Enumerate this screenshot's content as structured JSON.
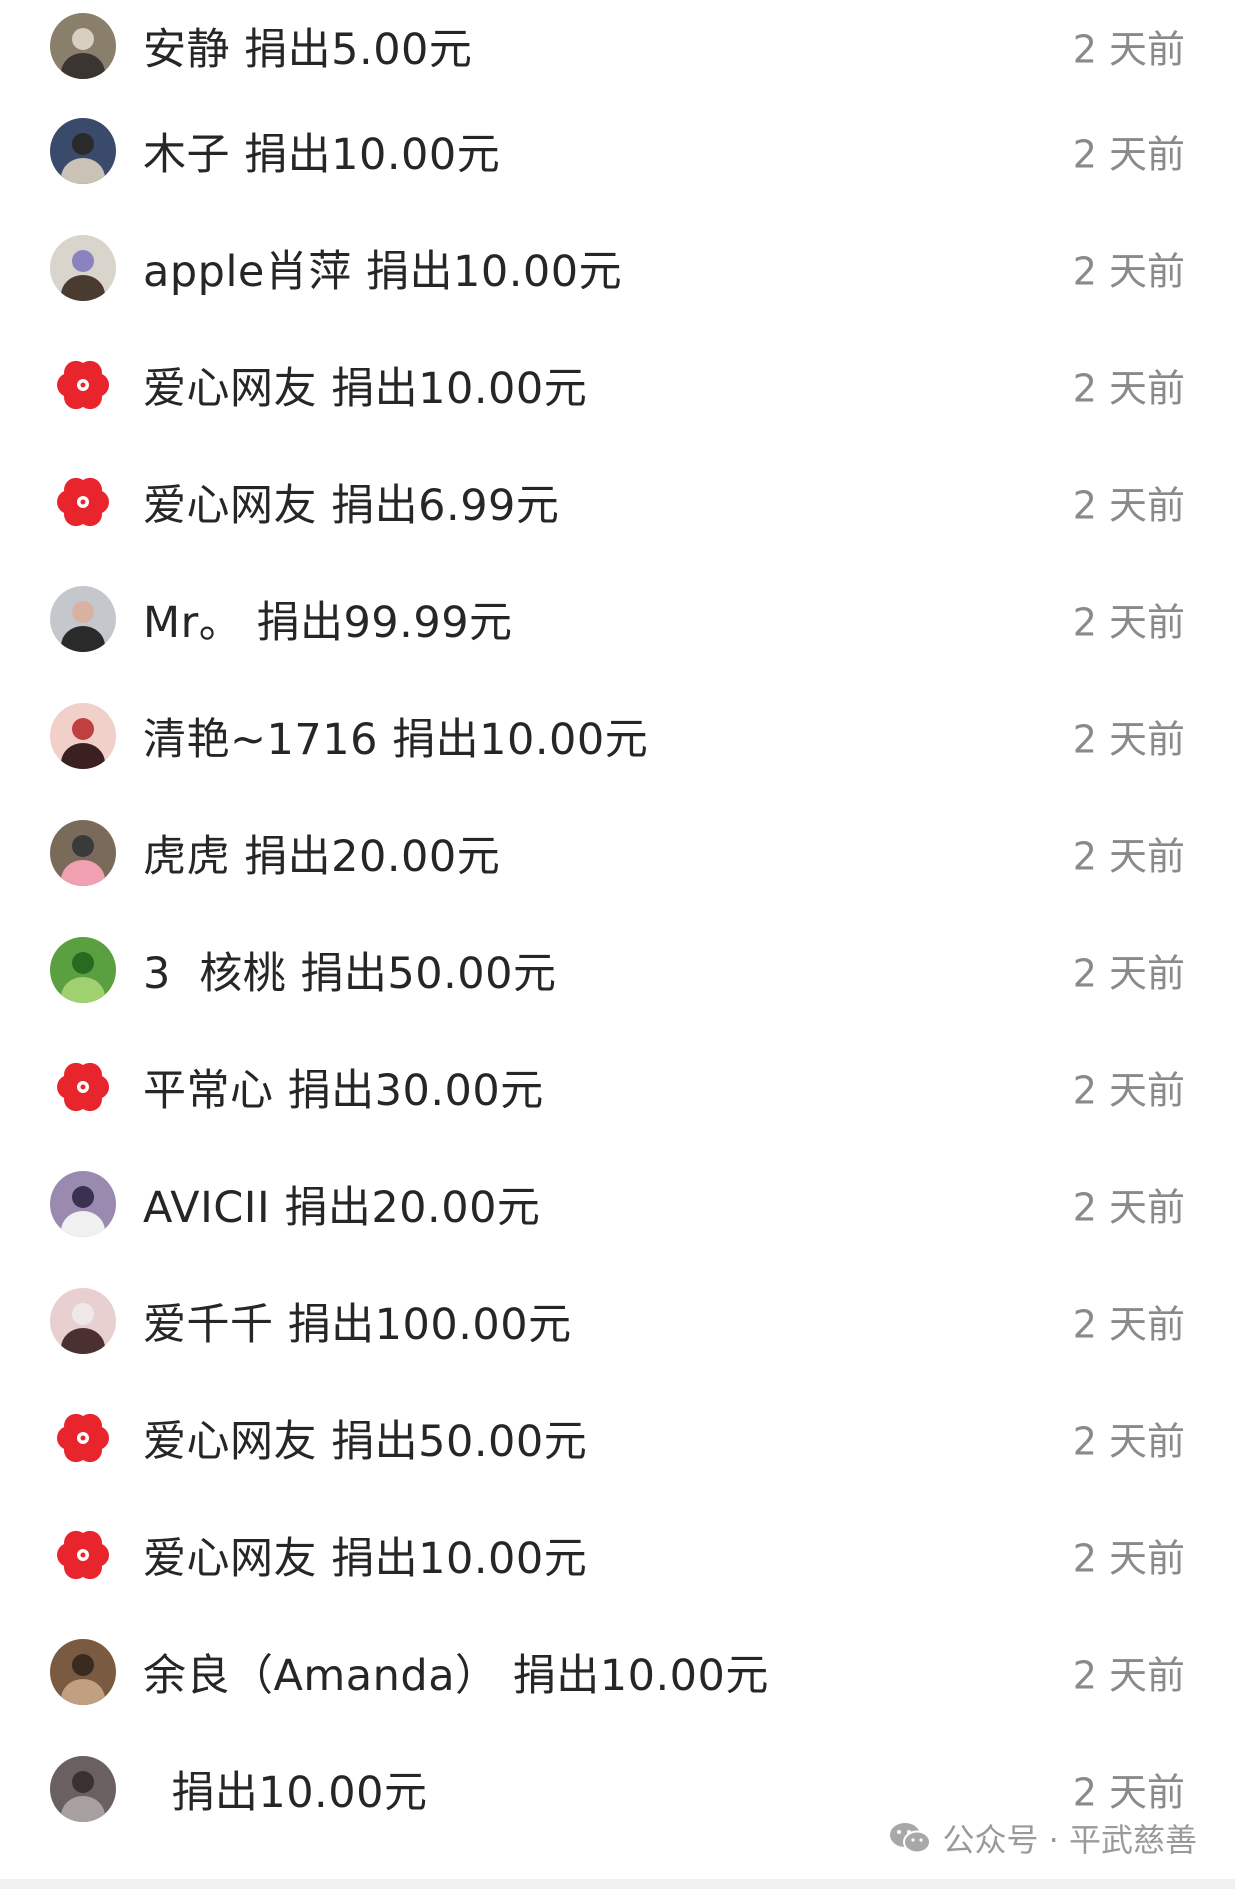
{
  "donations": [
    {
      "avatar": "avatar-photo",
      "name": "安静",
      "action": "捐出5.00元",
      "time": "2 天前"
    },
    {
      "avatar": "avatar-photo",
      "name": "木子",
      "action": "捐出10.00元",
      "time": "2 天前"
    },
    {
      "avatar": "avatar-photo",
      "name": "apple肖萍",
      "action": "捐出10.00元",
      "time": "2 天前"
    },
    {
      "avatar": "red-flower-icon",
      "name": "爱心网友",
      "action": "捐出10.00元",
      "time": "2 天前"
    },
    {
      "avatar": "red-flower-icon",
      "name": "爱心网友",
      "action": "捐出6.99元",
      "time": "2 天前"
    },
    {
      "avatar": "avatar-photo",
      "name": "Mr。",
      "action": "捐出99.99元",
      "time": "2 天前"
    },
    {
      "avatar": "avatar-photo",
      "name": "清艳~1716",
      "action": "捐出10.00元",
      "time": "2 天前"
    },
    {
      "avatar": "avatar-photo",
      "name": "虎虎",
      "action": "捐出20.00元",
      "time": "2 天前"
    },
    {
      "avatar": "avatar-photo",
      "name": "3  核桃",
      "action": "捐出50.00元",
      "time": "2 天前"
    },
    {
      "avatar": "red-flower-icon",
      "name": "平常心",
      "action": "捐出30.00元",
      "time": "2 天前"
    },
    {
      "avatar": "avatar-photo",
      "name": "AVICII",
      "action": "捐出20.00元",
      "time": "2 天前"
    },
    {
      "avatar": "avatar-photo",
      "name": "爱千千",
      "action": "捐出100.00元",
      "time": "2 天前"
    },
    {
      "avatar": "red-flower-icon",
      "name": "爱心网友",
      "action": "捐出50.00元",
      "time": "2 天前"
    },
    {
      "avatar": "red-flower-icon",
      "name": "爱心网友",
      "action": "捐出10.00元",
      "time": "2 天前"
    },
    {
      "avatar": "avatar-photo",
      "name": "余良（Amanda）",
      "action": "捐出10.00元",
      "time": "2 天前"
    },
    {
      "avatar": "avatar-photo",
      "name": "",
      "action": "捐出10.00元",
      "time": "2 天前"
    }
  ],
  "watermark": {
    "icon": "wechat-icon",
    "text": "公众号 · 平武慈善"
  },
  "colors": {
    "text": "#262626",
    "time": "#8a8a8a",
    "flower_red": "#e8242c"
  }
}
